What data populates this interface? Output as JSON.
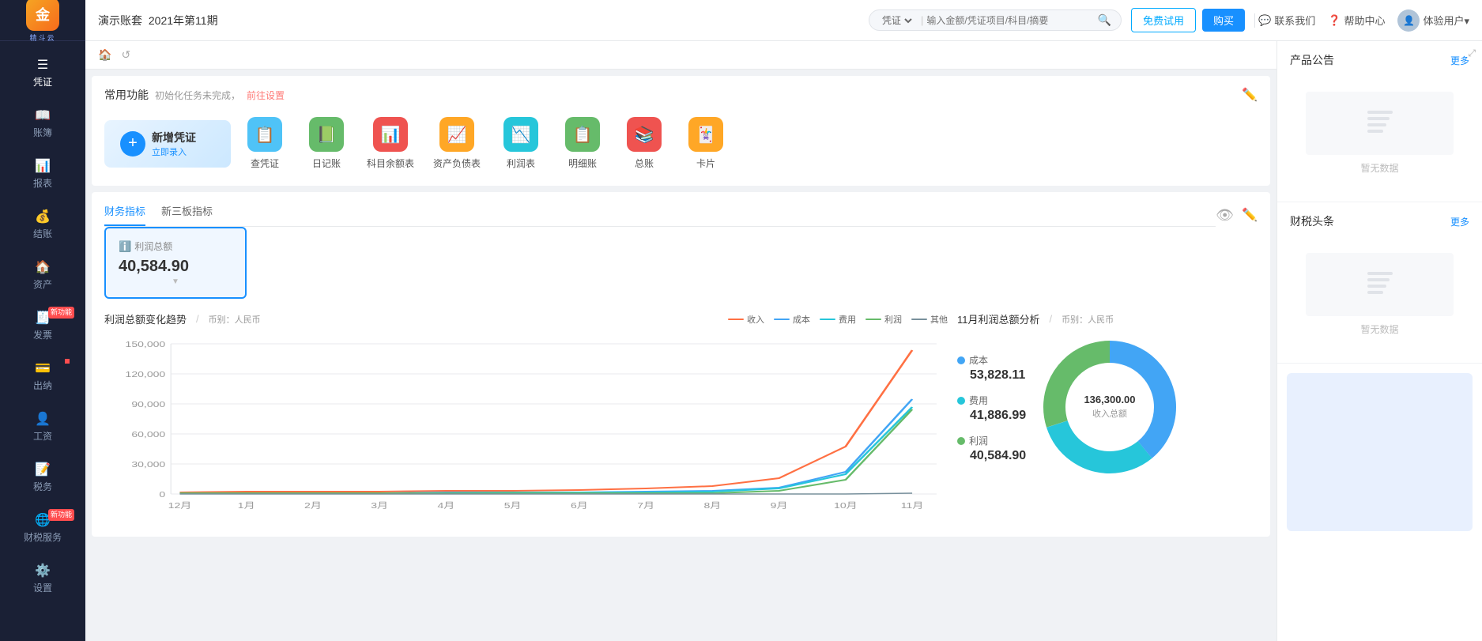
{
  "app": {
    "name": "金蝶精斗云",
    "logo_char": "金"
  },
  "topbar": {
    "company": "演示账套",
    "period": "2021年第11期",
    "search_placeholder": "输入金额/凭证项目/科目/摘要",
    "search_type": "凭证",
    "trial_btn": "免费试用",
    "buy_btn": "购买",
    "contact": "联系我们",
    "help": "帮助中心",
    "user": "体验用户▾"
  },
  "sidebar": {
    "items": [
      {
        "icon": "📋",
        "label": "凭证",
        "active": true
      },
      {
        "icon": "📖",
        "label": "账簿"
      },
      {
        "icon": "📊",
        "label": "报表"
      },
      {
        "icon": "💰",
        "label": "结账"
      },
      {
        "icon": "🏠",
        "label": "资产"
      },
      {
        "icon": "🧾",
        "label": "发票",
        "badge": "新功能"
      },
      {
        "icon": "💳",
        "label": "出纳",
        "badge_dot": true
      },
      {
        "icon": "👤",
        "label": "工资"
      },
      {
        "icon": "📝",
        "label": "税务"
      },
      {
        "icon": "🌐",
        "label": "财税服务",
        "badge": "新功能"
      },
      {
        "icon": "⚙️",
        "label": "设置"
      }
    ]
  },
  "common_features": {
    "title": "常用功能",
    "init_notice": "初始化任务未完成，",
    "init_link": "前往设置",
    "new_voucher": {
      "label": "新增凭证",
      "sub": "立即录入"
    },
    "items": [
      {
        "label": "查凭证",
        "icon": "📋",
        "color": "#4fc3f7"
      },
      {
        "label": "日记账",
        "icon": "📗",
        "color": "#66bb6a"
      },
      {
        "label": "科目余额表",
        "icon": "📊",
        "color": "#ef5350"
      },
      {
        "label": "资产负债表",
        "icon": "📈",
        "color": "#ffa726"
      },
      {
        "label": "利润表",
        "icon": "📉",
        "color": "#26c6da"
      },
      {
        "label": "明细账",
        "icon": "📋",
        "color": "#66bb6a"
      },
      {
        "label": "总账",
        "icon": "📚",
        "color": "#ef5350"
      },
      {
        "label": "卡片",
        "icon": "🃏",
        "color": "#ffa726"
      }
    ]
  },
  "indicators": {
    "tabs": [
      "财务指标",
      "新三板指标"
    ],
    "active_tab": 0,
    "kpi_cards": [
      {
        "label": "利润总额",
        "value": "40,584.90",
        "selected": true
      }
    ]
  },
  "chart_line": {
    "title": "利润总额变化趋势",
    "currency": "币别：人民币",
    "legend": [
      {
        "label": "收入",
        "color": "#ff7043"
      },
      {
        "label": "成本",
        "color": "#42a5f5"
      },
      {
        "label": "费用",
        "color": "#26c6da"
      },
      {
        "label": "利润",
        "color": "#66bb6a"
      },
      {
        "label": "其他",
        "color": "#78909c"
      }
    ],
    "x_labels": [
      "12月",
      "1月",
      "2月",
      "3月",
      "4月",
      "5月",
      "6月",
      "7月",
      "8月",
      "9月",
      "10月",
      "11月"
    ],
    "y_labels": [
      "0",
      "30,000",
      "60,000",
      "90,000",
      "120,000",
      "150,000"
    ]
  },
  "chart_donut": {
    "title": "11月利润总额分析",
    "currency": "币别：人民币",
    "center_value": "136,300.00",
    "center_label": "收入总额",
    "segments": [
      {
        "label": "成本",
        "value": "53,828.11",
        "color": "#42a5f5",
        "percent": 39
      },
      {
        "label": "费用",
        "value": "41,886.99",
        "color": "#26c6da",
        "percent": 31
      },
      {
        "label": "利润",
        "value": "40,584.90",
        "color": "#66bb6a",
        "percent": 30
      }
    ]
  },
  "right_panel": {
    "product_announcement": {
      "title": "产品公告",
      "more": "更多",
      "no_data": "暂无数据"
    },
    "finance_news": {
      "title": "财税头条",
      "more": "更多",
      "no_data": "暂无数据"
    }
  }
}
